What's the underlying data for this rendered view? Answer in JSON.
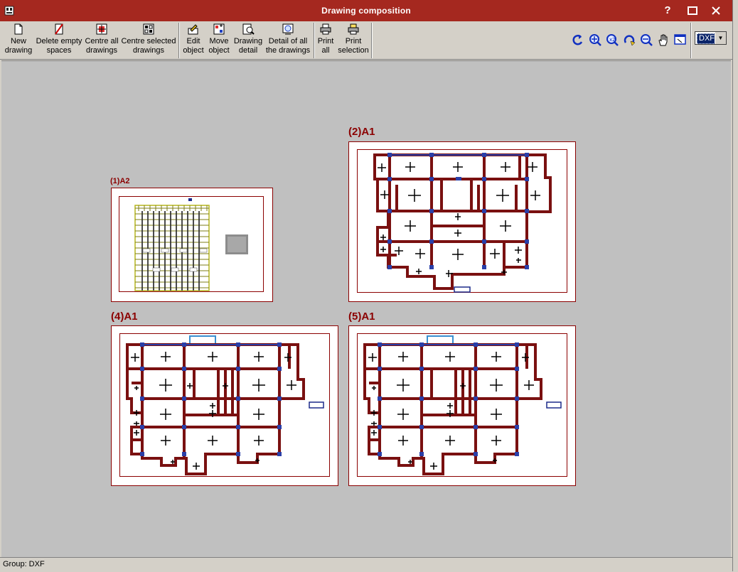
{
  "window": {
    "title": "Drawing composition"
  },
  "toolbar": {
    "group1": [
      {
        "id": "new-drawing",
        "line1": "New",
        "line2": "drawing"
      },
      {
        "id": "delete-empty-spaces",
        "line1": "Delete empty",
        "line2": "spaces"
      },
      {
        "id": "centre-all-drawings",
        "line1": "Centre all",
        "line2": "drawings"
      },
      {
        "id": "centre-selected-drawings",
        "line1": "Centre selected",
        "line2": "drawings"
      }
    ],
    "group2": [
      {
        "id": "edit-object",
        "line1": "Edit",
        "line2": "object"
      },
      {
        "id": "move-object",
        "line1": "Move",
        "line2": "object"
      },
      {
        "id": "drawing-detail",
        "line1": "Drawing",
        "line2": "detail"
      },
      {
        "id": "detail-all-drawings",
        "line1": "Detail of all",
        "line2": "the drawings"
      }
    ],
    "group3": [
      {
        "id": "print-all",
        "line1": "Print",
        "line2": "all"
      },
      {
        "id": "print-selection",
        "line1": "Print",
        "line2": "selection"
      }
    ],
    "format_value": "DXF"
  },
  "sheets": [
    {
      "label": "(1)A2"
    },
    {
      "label": "(2)A1"
    },
    {
      "label": "(4)A1"
    },
    {
      "label": "(5)A1"
    }
  ],
  "status": {
    "text": "Group: DXF"
  },
  "colors": {
    "titlebar": "#a5281f",
    "sheet_border": "#8b0000",
    "beam": "#7a1010",
    "column": "#2a3fa8"
  }
}
